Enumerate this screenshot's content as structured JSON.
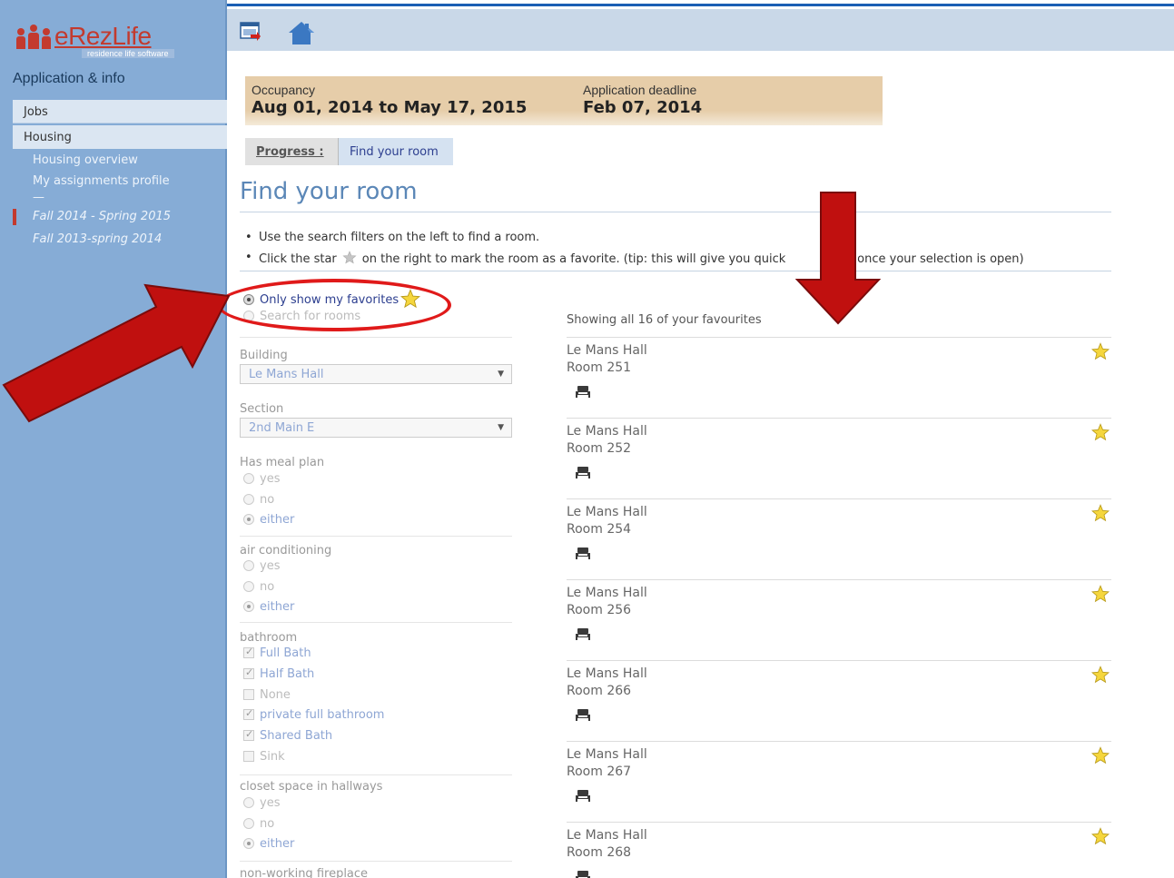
{
  "brand": {
    "name": "eRezLife",
    "tagline": "residence life software"
  },
  "sidebar": {
    "section_title": "Application & info",
    "items": [
      {
        "label": "Jobs"
      },
      {
        "label": "Housing"
      }
    ],
    "sub_items": [
      {
        "label": "Housing overview"
      },
      {
        "label": "My assignments profile"
      },
      {
        "label": "—"
      },
      {
        "label": "Fall 2014 - Spring 2015"
      },
      {
        "label": "Fall 2013-spring 2014"
      }
    ]
  },
  "banner": {
    "occupancy_label": "Occupancy",
    "occupancy_value": "Aug 01, 2014 to May 17, 2015",
    "deadline_label": "Application deadline",
    "deadline_value": "Feb 07, 2014"
  },
  "progress": {
    "label": "Progress :",
    "step": "Find your room"
  },
  "page": {
    "title": "Find your room",
    "tip1": "Use the search filters on the left to find a room.",
    "tip2_before": "Click the star",
    "tip2_after": "on the right to mark the room as a favorite. (tip: this will give you quick",
    "tip2_end": "s once your selection is open)"
  },
  "filters": {
    "favorites_only": "Only show my favorites",
    "search_rooms": "Search for rooms",
    "building_label": "Building",
    "building_value": "Le Mans Hall",
    "section_label": "Section",
    "section_value": "2nd Main E",
    "meal_label": "Has meal plan",
    "ac_label": "air conditioning",
    "closet_label": "closet space in hallways",
    "fireplace_label": "non-working fireplace",
    "opt_yes": "yes",
    "opt_no": "no",
    "opt_either": "either",
    "bathroom_label": "bathroom",
    "bath_options": [
      "Full Bath",
      "Half Bath",
      "None",
      "private full bathroom",
      "Shared Bath",
      "Sink"
    ]
  },
  "results": {
    "summary": "Showing all 16 of your favourites",
    "rooms": [
      {
        "hall": "Le Mans Hall",
        "room": "Room 251"
      },
      {
        "hall": "Le Mans Hall",
        "room": "Room 252"
      },
      {
        "hall": "Le Mans Hall",
        "room": "Room 254"
      },
      {
        "hall": "Le Mans Hall",
        "room": "Room 256"
      },
      {
        "hall": "Le Mans Hall",
        "room": "Room 266"
      },
      {
        "hall": "Le Mans Hall",
        "room": "Room 267"
      },
      {
        "hall": "Le Mans Hall",
        "room": "Room 268"
      }
    ]
  },
  "colors": {
    "sidebar": "#86acd6",
    "accent": "#5b87b7",
    "annotation": "#c0100f"
  }
}
